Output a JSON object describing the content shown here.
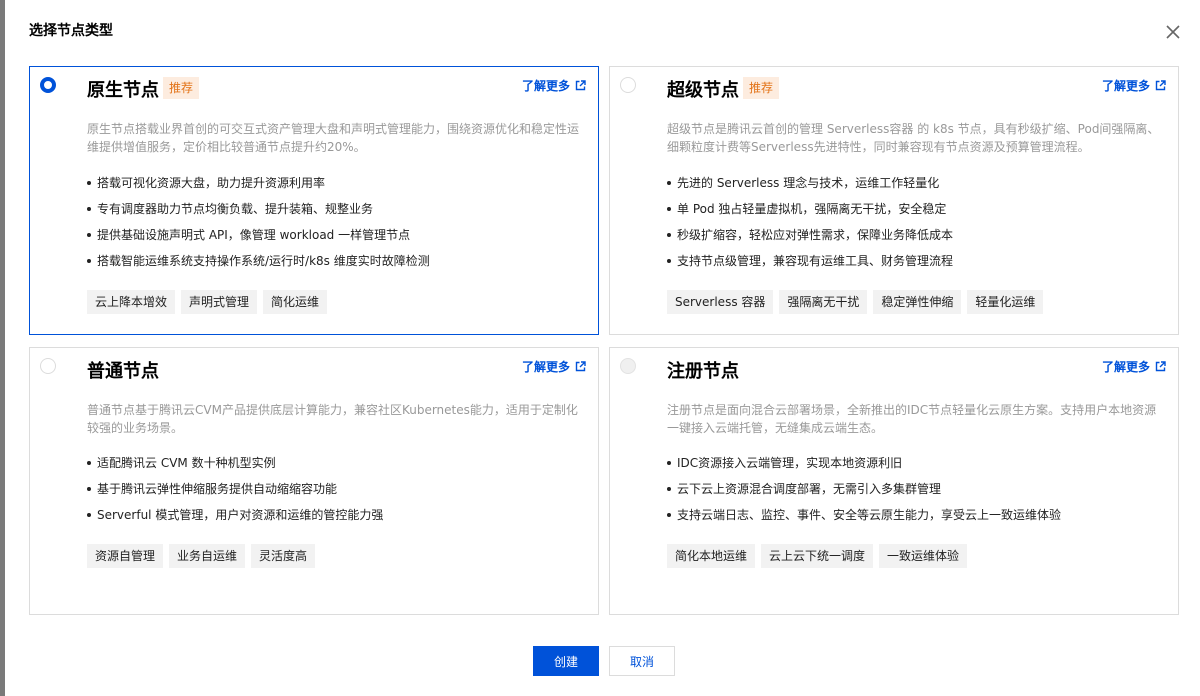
{
  "dialog": {
    "title": "选择节点类型",
    "close_icon": "close-icon"
  },
  "cards": [
    {
      "title": "原生节点",
      "badge": "推荐",
      "learn_more": "了解更多",
      "selected": true,
      "description": "原生节点搭载业界首创的可交互式资产管理大盘和声明式管理能力，围绕资源优化和稳定性运维提供增值服务，定价相比较普通节点提升约20%。",
      "features": [
        "搭载可视化资源大盘，助力提升资源利用率",
        "专有调度器助力节点均衡负载、提升装箱、规整业务",
        "提供基础设施声明式 API，像管理 workload 一样管理节点",
        "搭载智能运维系统支持操作系统/运行时/k8s 维度实时故障检测"
      ],
      "tags": [
        "云上降本增效",
        "声明式管理",
        "简化运维"
      ]
    },
    {
      "title": "超级节点",
      "badge": "推荐",
      "learn_more": "了解更多",
      "selected": false,
      "description": "超级节点是腾讯云首创的管理 Serverless容器 的 k8s 节点，具有秒级扩缩、Pod间强隔离、细颗粒度计费等Serverless先进特性，同时兼容现有节点资源及预算管理流程。",
      "features": [
        "先进的 Serverless 理念与技术，运维工作轻量化",
        "单 Pod 独占轻量虚拟机，强隔离无干扰，安全稳定",
        "秒级扩缩容，轻松应对弹性需求，保障业务降低成本",
        "支持节点级管理，兼容现有运维工具、财务管理流程"
      ],
      "tags": [
        "Serverless 容器",
        "强隔离无干扰",
        "稳定弹性伸缩",
        "轻量化运维"
      ]
    },
    {
      "title": "普通节点",
      "badge": "",
      "learn_more": "了解更多",
      "selected": false,
      "description": "普通节点基于腾讯云CVM产品提供底层计算能力，兼容社区Kubernetes能力，适用于定制化较强的业务场景。",
      "features": [
        "适配腾讯云 CVM 数十种机型实例",
        "基于腾讯云弹性伸缩服务提供自动缩缩容功能",
        "Serverful 模式管理，用户对资源和运维的管控能力强"
      ],
      "tags": [
        "资源自管理",
        "业务自运维",
        "灵活度高"
      ]
    },
    {
      "title": "注册节点",
      "badge": "",
      "learn_more": "了解更多",
      "selected": false,
      "description": "注册节点是面向混合云部署场景，全新推出的IDC节点轻量化云原生方案。支持用户本地资源一键接入云端托管，无缝集成云端生态。",
      "features": [
        "IDC资源接入云端管理，实现本地资源利旧",
        "云下云上资源混合调度部署，无需引入多集群管理",
        "支持云端日志、监控、事件、安全等云原生能力，享受云上一致运维体验"
      ],
      "tags": [
        "简化本地运维",
        "云上云下统一调度",
        "一致运维体验"
      ]
    }
  ],
  "footer": {
    "create_label": "创建",
    "cancel_label": "取消"
  },
  "colors": {
    "primary": "#0052d9",
    "badge_bg": "#fdecdf",
    "badge_text": "#e37318"
  }
}
